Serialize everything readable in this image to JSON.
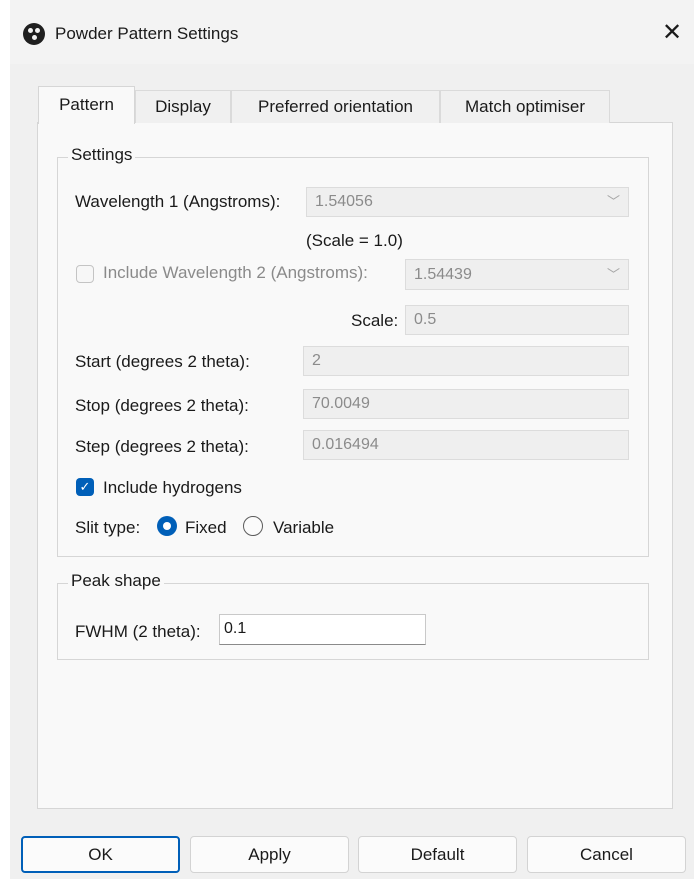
{
  "window": {
    "title": "Powder Pattern Settings",
    "close_glyph": "✕"
  },
  "tabs": [
    {
      "label": "Pattern",
      "active": true
    },
    {
      "label": "Display",
      "active": false
    },
    {
      "label": "Preferred orientation",
      "active": false
    },
    {
      "label": "Match optimiser",
      "active": false
    }
  ],
  "settings": {
    "title": "Settings",
    "wavelength1_label": "Wavelength 1 (Angstroms):",
    "wavelength1_value": "1.54056",
    "scale_note": "(Scale = 1.0)",
    "include_wavelength2_label": "Include Wavelength 2 (Angstroms):",
    "include_wavelength2_checked": false,
    "wavelength2_value": "1.54439",
    "scale_label": "Scale:",
    "scale_value": "0.5",
    "start_label": "Start (degrees 2 theta):",
    "start_value": "2",
    "stop_label": "Stop (degrees 2 theta):",
    "stop_value": "70.0049",
    "step_label": "Step (degrees 2 theta):",
    "step_value": "0.016494",
    "include_hydrogens_label": "Include hydrogens",
    "include_hydrogens_checked": true,
    "slit_type_label": "Slit type:",
    "slit_fixed_label": "Fixed",
    "slit_variable_label": "Variable",
    "slit_selected": "Fixed"
  },
  "peak_shape": {
    "title": "Peak shape",
    "fwhm_label": "FWHM (2 theta):",
    "fwhm_value": "0.1"
  },
  "buttons": {
    "ok": "OK",
    "apply": "Apply",
    "default": "Default",
    "cancel": "Cancel"
  },
  "icons": {
    "app": "app-icon",
    "combo_arrow": "chevron-down-icon",
    "check": "checkmark-icon"
  },
  "colors": {
    "accent": "#005fb8",
    "disabled_text": "#8b8b8b"
  }
}
